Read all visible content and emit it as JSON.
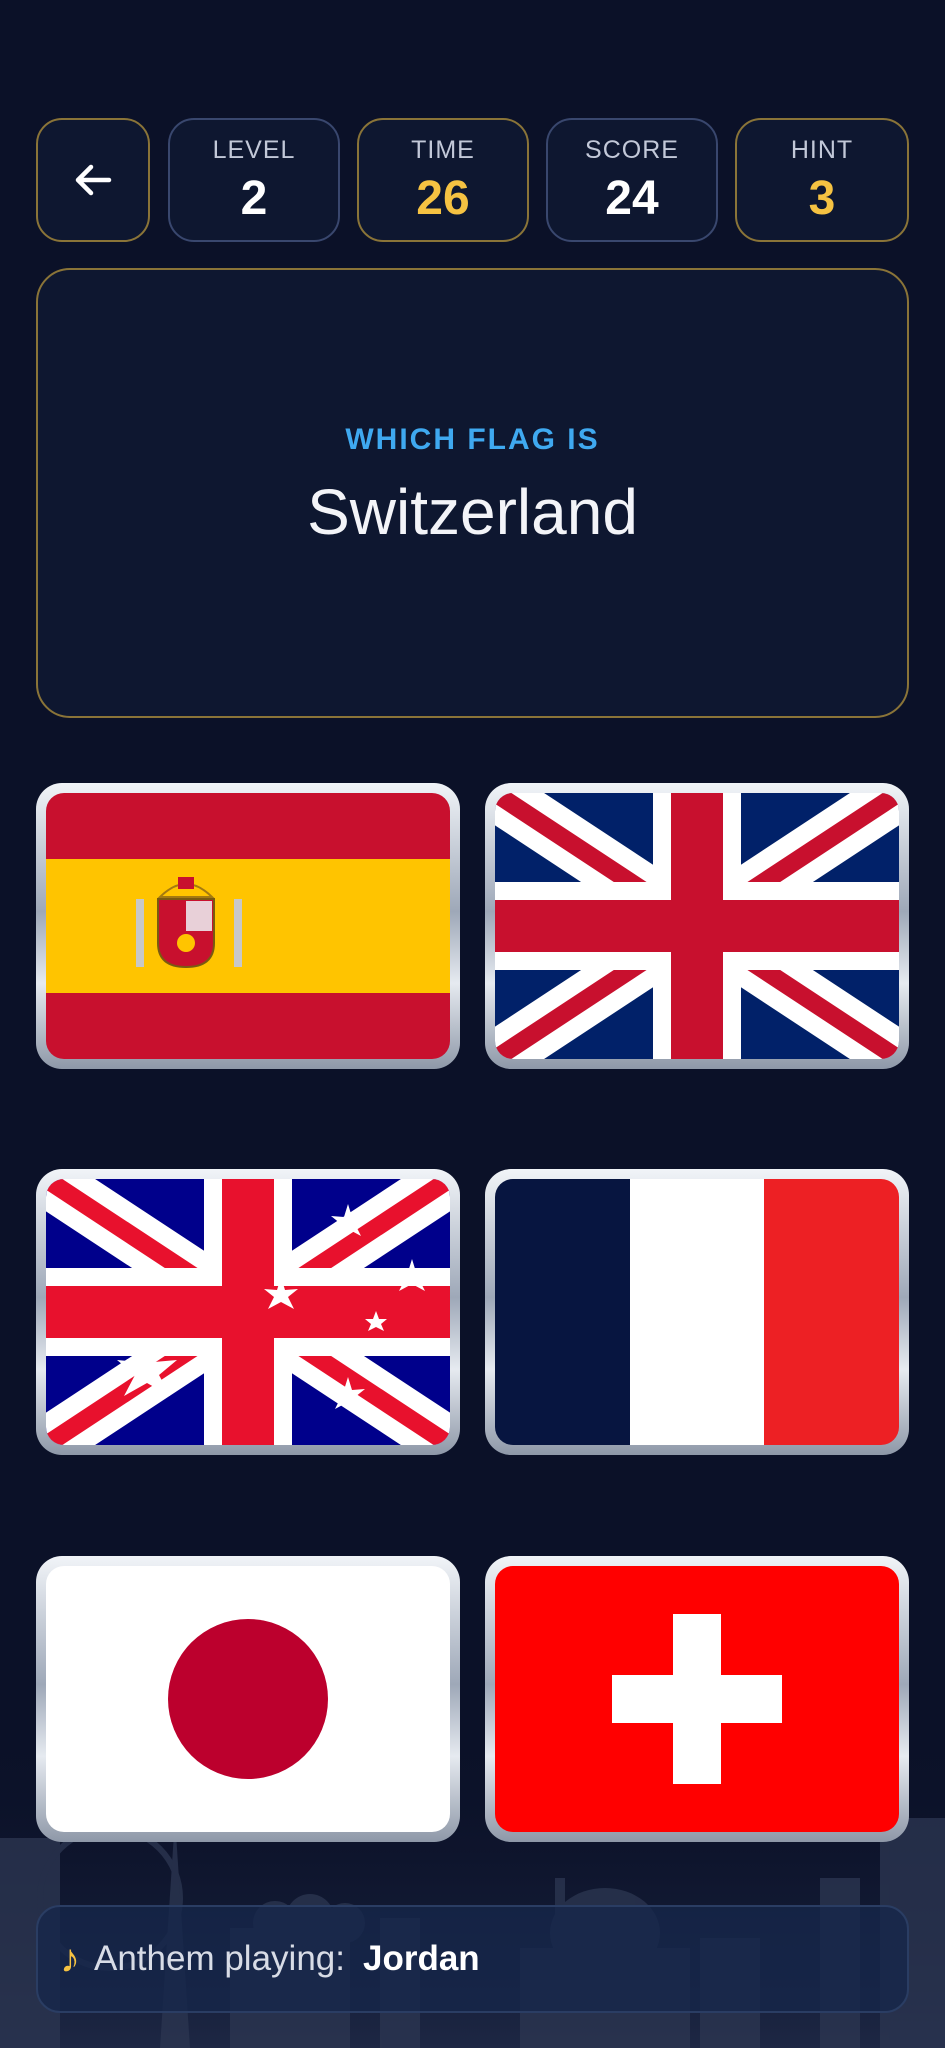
{
  "hud": {
    "level": {
      "label": "LEVEL",
      "value": "2"
    },
    "time": {
      "label": "TIME",
      "value": "26"
    },
    "score": {
      "label": "SCORE",
      "value": "24"
    },
    "hint": {
      "label": "HINT",
      "value": "3"
    }
  },
  "question": {
    "prompt": "WHICH FLAG IS",
    "country": "Switzerland"
  },
  "options": [
    "spain-flag",
    "united-kingdom-flag",
    "australia-flag",
    "france-flag",
    "japan-flag",
    "switzerland-flag"
  ],
  "anthem": {
    "label": "Anthem playing:",
    "value": "Jordan"
  },
  "colors": {
    "gold": "#f5c242",
    "accent_blue": "#3fa9f0",
    "background": "#0b1128"
  }
}
